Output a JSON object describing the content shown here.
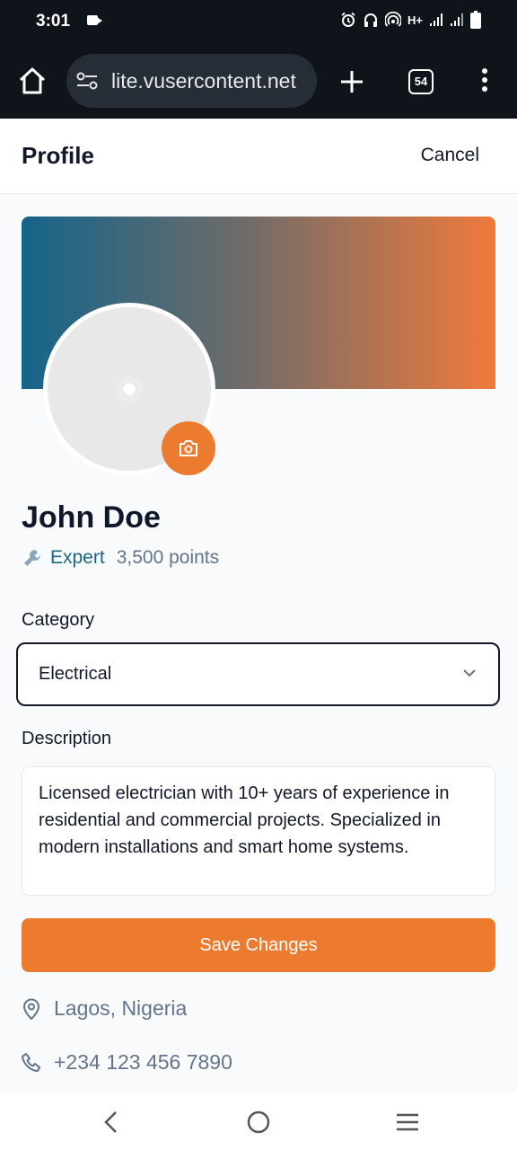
{
  "status_bar": {
    "time": "3:01",
    "network": "H+"
  },
  "browser": {
    "url": "lite.vusercontent.net",
    "tab_count": "54"
  },
  "header": {
    "title": "Profile",
    "cancel_label": "Cancel"
  },
  "profile": {
    "name": "John Doe",
    "level": "Expert",
    "points": "3,500 points",
    "category_label": "Category",
    "category_value": "Electrical",
    "description_label": "Description",
    "description": "Licensed electrician with 10+ years of experience in residential and commercial projects. Specialized in modern installations and smart home systems.",
    "save_label": "Save Changes",
    "location": "Lagos, Nigeria",
    "phone": "+234 123 456 7890"
  },
  "icons": {
    "status": [
      "video-camera-icon",
      "alarm-icon",
      "headphones-icon",
      "hotspot-icon",
      "signal-icon",
      "signal-icon",
      "battery-icon"
    ],
    "browser": [
      "home-icon",
      "site-settings-icon",
      "plus-icon",
      "tabs-icon",
      "more-vert-icon"
    ],
    "page": [
      "camera-icon",
      "wrench-icon",
      "chevron-down-icon",
      "location-pin-icon",
      "phone-icon"
    ],
    "nav": [
      "back-icon",
      "home-circle-icon",
      "recents-icon"
    ]
  },
  "colors": {
    "accent": "#ed7b2f",
    "level": "#1d6585",
    "cover_start": "#15648a",
    "cover_end": "#f07a3c"
  }
}
